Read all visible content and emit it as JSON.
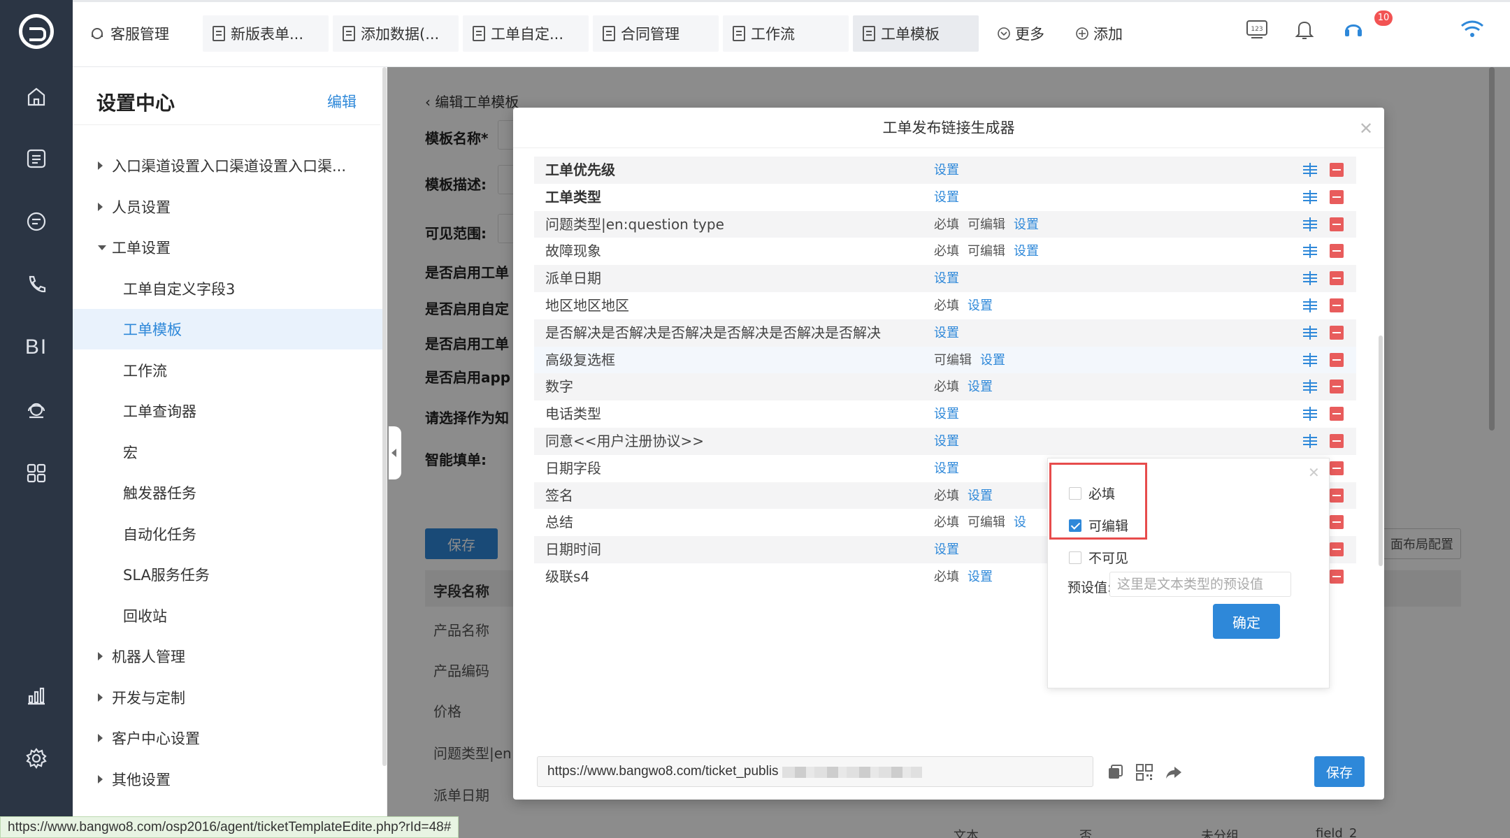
{
  "topbar": {
    "tabs": [
      {
        "label": "客服管理",
        "icon": "headset-icon"
      },
      {
        "label": "新版表单...",
        "icon": "doc-icon"
      },
      {
        "label": "添加数据(...",
        "icon": "doc-icon"
      },
      {
        "label": "工单自定...",
        "icon": "doc-icon"
      },
      {
        "label": "合同管理",
        "icon": "doc-icon"
      },
      {
        "label": "工作流",
        "icon": "doc-icon"
      },
      {
        "label": "工单模板",
        "icon": "doc-icon",
        "active": true
      }
    ],
    "more_label": "更多",
    "add_label": "添加",
    "notification_count": "10"
  },
  "settings": {
    "title": "设置中心",
    "edit_label": "编辑",
    "items": [
      {
        "label": "入口渠道设置入口渠道设置入口渠...",
        "type": "group"
      },
      {
        "label": "人员设置",
        "type": "group"
      },
      {
        "label": "工单设置",
        "type": "group",
        "open": true
      },
      {
        "label": "工单自定义字段3",
        "type": "child"
      },
      {
        "label": "工单模板",
        "type": "child",
        "active": true
      },
      {
        "label": "工作流",
        "type": "child"
      },
      {
        "label": "工单查询器",
        "type": "child"
      },
      {
        "label": "宏",
        "type": "child"
      },
      {
        "label": "触发器任务",
        "type": "child"
      },
      {
        "label": "自动化任务",
        "type": "child"
      },
      {
        "label": "SLA服务任务",
        "type": "child"
      },
      {
        "label": "回收站",
        "type": "child"
      },
      {
        "label": "机器人管理",
        "type": "group"
      },
      {
        "label": "开发与定制",
        "type": "group"
      },
      {
        "label": "客户中心设置",
        "type": "group"
      },
      {
        "label": "其他设置",
        "type": "group"
      }
    ]
  },
  "main": {
    "back_label": "编辑工单模板",
    "labels": [
      "模板名称*",
      "模板描述:",
      "可见范围:",
      "是否启用工单",
      "是否启用自定",
      "是否启用工单",
      "是否启用app",
      "请选择作为知",
      "智能填单:"
    ],
    "save_label": "保存",
    "layout_label": "面布局配置",
    "table_header": "字段名称",
    "table_rows": [
      "产品名称",
      "产品编码",
      "价格",
      "问题类型|en:",
      "派单日期"
    ],
    "bottom_cells": [
      "文本",
      "否",
      "未分组",
      "field_2"
    ]
  },
  "modal": {
    "title": "工单发布链接生成器",
    "fields": [
      {
        "name": "工单优先级",
        "bold": true,
        "tags": [],
        "link": "设置"
      },
      {
        "name": "工单类型",
        "bold": true,
        "tags": [],
        "link": "设置"
      },
      {
        "name": "问题类型|en:question type",
        "tags": [
          "必填",
          "可编辑"
        ],
        "link": "设置"
      },
      {
        "name": "故障现象",
        "tags": [
          "必填",
          "可编辑"
        ],
        "link": "设置"
      },
      {
        "name": "派单日期",
        "tags": [],
        "link": "设置"
      },
      {
        "name": "地区地区地区",
        "tags": [
          "必填"
        ],
        "link": "设置"
      },
      {
        "name": "是否解决是否解决是否解决是否解决是否解决是否解决",
        "tags": [],
        "link": "设置"
      },
      {
        "name": "高级复选框",
        "tags": [
          "可编辑"
        ],
        "link": "设置",
        "highlight": true
      },
      {
        "name": "数字",
        "tags": [
          "必填"
        ],
        "link": "设置"
      },
      {
        "name": "电话类型",
        "tags": [],
        "link": "设置"
      },
      {
        "name": "同意<<用户注册协议>>",
        "tags": [],
        "link": "设置"
      },
      {
        "name": "日期字段",
        "tags": [],
        "link": "设置"
      },
      {
        "name": "签名",
        "tags": [
          "必填"
        ],
        "link": "设置"
      },
      {
        "name": "总结",
        "tags": [
          "必填",
          "可编辑"
        ],
        "link": "设"
      },
      {
        "name": "日期时间",
        "tags": [],
        "link": "设置"
      },
      {
        "name": "级联s4",
        "tags": [
          "必填"
        ],
        "link": "设置"
      }
    ],
    "url": "https://www.bangwo8.com/ticket_publis",
    "save_label": "保存"
  },
  "popover": {
    "options": [
      {
        "label": "必填",
        "checked": false
      },
      {
        "label": "可编辑",
        "checked": true
      },
      {
        "label": "不可见",
        "checked": false
      }
    ],
    "preset_label": "预设值:",
    "preset_placeholder": "这里是文本类型的预设值",
    "ok_label": "确定"
  },
  "statusbar": {
    "url": "https://www.bangwo8.com/osp2016/agent/ticketTemplateEdite.php?rId=48#"
  },
  "colors": {
    "accent": "#2e88d9",
    "rail": "#2b3544",
    "danger": "#e85c5c"
  }
}
